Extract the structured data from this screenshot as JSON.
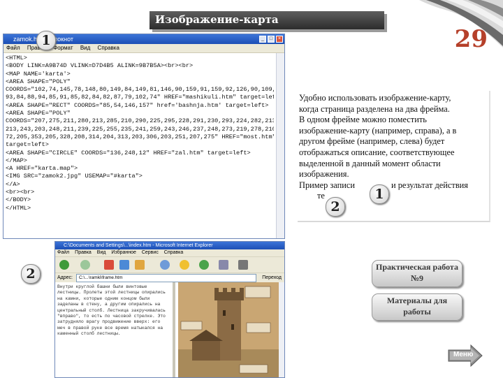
{
  "slide": {
    "title": "Изображение-карта",
    "page_number": "29"
  },
  "notepad": {
    "title": "zamok.htm - Блокнот",
    "menu": [
      "Файл",
      "Правка",
      "Формат",
      "Вид",
      "Справка"
    ],
    "lines": [
      "<HTML>",
      "<BODY LINK=A9B74D VLINK=D7D4B5 ALINK=9B7B5A><br><br>",
      "<MAP NAME='karta'>",
      "<AREA SHAPE=\"POLY\"",
      "COORDS=\"102,74,145,78,148,80,149,84,149,81,146,90,159,91,159,92,126,90,109,30,",
      "93,84,88,94,85,91,85,82,84,82,87,79,102,74\" HREF=\"mashikuli.htm\" target=left >",
      "<AREA SHAPE=\"RECT\" COORDS=\"85,54,146,157\" href='bashnja.htm' target=left>",
      "<AREA SHAPE=\"POLY\"",
      "COORDS=\"207,275,211,280,213,285,210,290,225,295,228,291,230,293,224,282,213,279,",
      "213,243,203,248,211,239,225,255,235,241,259,243,246,237,248,273,219,278,210,3",
      "72,205,353,205,328,208,314,204,313,203,306,203,251,207,275\" HREF=\"most.htm\"",
      "target=left>",
      "<AREA SHAPE=\"CIRCLE\" COORDS=\"136,248,12\" HREF=\"zal.htm\" target=left>",
      "</MAP>",
      "<A HREF=\"karta.map\">",
      "<IMG SRC=\"zamok2.jpg\" USEMAP=\"#karta\">",
      "</A>",
      "<br><br>",
      "</BODY>",
      "</HTML>"
    ]
  },
  "ie": {
    "title": "C:\\Documents and Settings\\...\\index.htm - Microsoft Internet Explorer",
    "menu": [
      "Файл",
      "Правка",
      "Вид",
      "Избранное",
      "Сервис",
      "Справка"
    ],
    "address_label": "Адрес:",
    "address": "C:\\...\\ramki\\frame.htm",
    "go_label": "Переход",
    "left_text": "Внутри круглой башни были винтовые лестницы. Пролеты этой лестницы опирались на камни, которые одним концом были заделаны в стену, а другим опирались на центральный столб. Лестница закручивалась \"вправо\", то есть по часовой стрелке. Это затрудняло врагу продвижение вверх: его меч в правой руке все время натыкался на каменный столб лестницы."
  },
  "badges": {
    "one": "1",
    "two": "2"
  },
  "info": {
    "lines": [
      "Удобно использовать изображение-карту,",
      "когда страница разделена на два фрейма.",
      "В одном фрейме можно поместить",
      "изображение-карту (например, справа), а в",
      "другом фрейме (например, слева) будет",
      "отображаться описание, соответствующее",
      "выделенной в данный момент области",
      "изображения."
    ],
    "example_start": "Пример записи",
    "example_end": "и результат действия",
    "example_last": "те"
  },
  "buttons": {
    "practical": "Практическая работа №9",
    "materials": "Материалы для работы",
    "menu": "Меню"
  },
  "colors": {
    "title_bar": "#3d3d3d",
    "page_number": "#b5402a",
    "xp_blue": "#1d4fb5",
    "photo_sepia": "#c9a673"
  }
}
